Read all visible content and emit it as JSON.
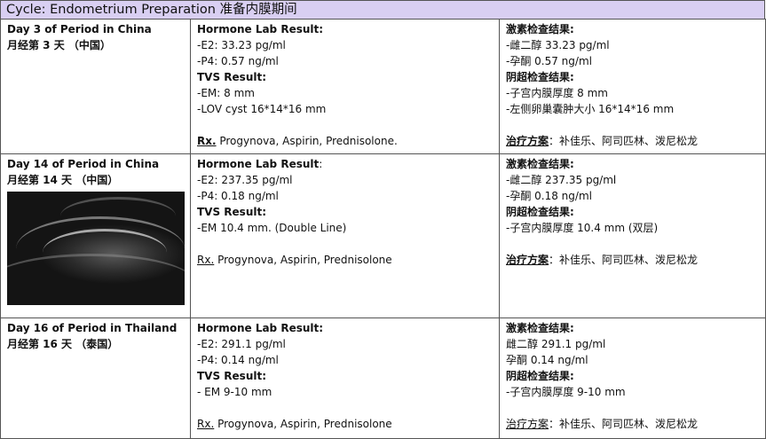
{
  "title": "Cycle: Endometrium Preparation 准备内膜期间",
  "rows": [
    {
      "day_en": "Day 3 of Period in China",
      "day_cn": "月经第 3 天 （中国）",
      "en": {
        "hormone_head": "Hormone Lab Result",
        "hormone_colon": ":",
        "e2": "-E2: 33.23 pg/ml",
        "p4": "-P4: 0.57 ng/ml",
        "tvs_head": "TVS Result:",
        "em": "-EM: 8 mm",
        "lov": "-LOV cyst 16*14*16 mm",
        "rx_label": "Rx.",
        "rx": " Progynova, Aspirin, Prednisolone."
      },
      "cn": {
        "hormone_head": "激素检查结果:",
        "e2": "-雌二醇 33.23 pg/ml",
        "p4": "-孕酮 0.57 ng/ml",
        "tvs_head": "阴超检查结果:",
        "em": "-子宫内膜厚度 8 mm",
        "lov": "-左侧卵巢囊肿大小 16*14*16 mm",
        "rx_label": "治疗方案",
        "rx": "：补佳乐、阿司匹林、泼尼松龙"
      }
    },
    {
      "day_en": "Day 14 of Period in China",
      "day_cn": "月经第 14 天 （中国）",
      "en": {
        "hormone_head": "Hormone Lab Result",
        "hormone_colon": ":",
        "e2": "-E2: 237.35 pg/ml",
        "p4": "-P4: 0.18 ng/ml",
        "tvs_head": "TVS Result:",
        "em": "-EM 10.4 mm. (Double Line)",
        "rx_label": "Rx.",
        "rx": " Progynova, Aspirin, Prednisolone"
      },
      "cn": {
        "hormone_head": "激素检查结果:",
        "e2": "-雌二醇 237.35 pg/ml",
        "p4": "-孕酮 0.18 ng/ml",
        "tvs_head": "阴超检查结果:",
        "em": "-子宫内膜厚度 10.4 mm (双层)",
        "rx_label": "治疗方案",
        "rx": "：补佳乐、阿司匹林、泼尼松龙"
      }
    },
    {
      "day_en": "Day 16 of Period in Thailand",
      "day_cn": "月经第 16 天 （泰国）",
      "en": {
        "hormone_head": "Hormone Lab Result",
        "hormone_colon": ":",
        "e2": "-E2: 291.1 pg/ml",
        "p4": "-P4: 0.14 ng/ml",
        "tvs_head": "TVS Result:",
        "em": "- EM 9-10 mm",
        "rx_label": "Rx.",
        "rx": " Progynova, Aspirin, Prednisolone"
      },
      "cn": {
        "hormone_head": "激素检查结果:",
        "e2": "雌二醇 291.1 pg/ml",
        "p4": "孕酮 0.14 ng/ml",
        "tvs_head": "阴超检查结果:",
        "em": "-子宫内膜厚度 9-10 mm",
        "rx_label": "治疗方案",
        "rx": "：补佳乐、阿司匹林、泼尼松龙"
      }
    }
  ],
  "colors": {
    "title_bg": "#d9cff2",
    "border": "#555555",
    "text": "#111111"
  }
}
